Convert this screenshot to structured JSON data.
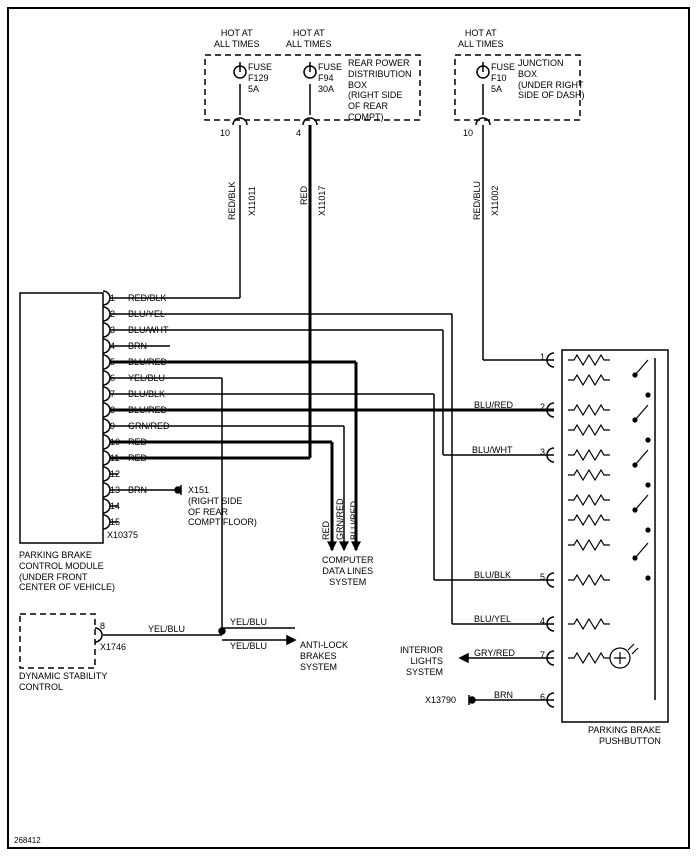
{
  "hot_at_all_times": "HOT AT\nALL TIMES",
  "fuse": "FUSE",
  "fuse_f129": "F129",
  "amp_5a": "5A",
  "fuse_f94": "F94",
  "amp_30a": "30A",
  "fuse_f10": "F10",
  "rear_power_box": "REAR POWER\nDISTRIBUTION\nBOX\n(RIGHT SIDE\nOF REAR\nCOMPT)",
  "junction_box": "JUNCTION\nBOX\n(UNDER RIGHT\nSIDE OF DASH)",
  "conn_pin_10": "10",
  "conn_pin_4": "4",
  "x11011": "X11011",
  "x11017": "X11017",
  "x11002": "X11002",
  "wire_red_blk": "RED/BLK",
  "wire_red": "RED",
  "wire_red_blu": "RED/BLU",
  "module_pins": [
    {
      "n": "1",
      "c": "RED/BLK"
    },
    {
      "n": "2",
      "c": "BLU/YEL"
    },
    {
      "n": "3",
      "c": "BLU/WHT"
    },
    {
      "n": "4",
      "c": "BRN"
    },
    {
      "n": "5",
      "c": "BLU/RED"
    },
    {
      "n": "6",
      "c": "YEL/BLU"
    },
    {
      "n": "7",
      "c": "BLU/BLK"
    },
    {
      "n": "8",
      "c": "BLU/RED"
    },
    {
      "n": "9",
      "c": "GRN/RED"
    },
    {
      "n": "10",
      "c": "RED"
    },
    {
      "n": "11",
      "c": "RED"
    },
    {
      "n": "12",
      "c": ""
    },
    {
      "n": "13",
      "c": "BRN"
    },
    {
      "n": "14",
      "c": ""
    },
    {
      "n": "15",
      "c": ""
    }
  ],
  "x10375": "X10375",
  "parking_brake_module": "PARKING BRAKE\nCONTROL MODULE\n(UNDER FRONT\nCENTER OF VEHICLE)",
  "x151_label": "X151\n(RIGHT SIDE\nOF REAR\nCOMPT FLOOR)",
  "computer_data": "COMPUTER\nDATA LINES\nSYSTEM",
  "conn8": "8",
  "x1746": "X1746",
  "dynamic_stability": "DYNAMIC STABILITY\nCONTROL",
  "yel_blu": "YEL/BLU",
  "anti_lock_brakes": "ANTI-LOCK\nBRAKES\nSYSTEM",
  "interior_lights": "INTERIOR\nLIGHTS\nSYSTEM",
  "gry_red": "GRY/RED",
  "brn": "BRN",
  "x13790": "X13790",
  "pushbutton_pins": [
    {
      "n": "1",
      "c": ""
    },
    {
      "n": "2",
      "c": "BLU/RED"
    },
    {
      "n": "3",
      "c": "BLU/WHT"
    },
    {
      "n": "5",
      "c": "BLU/BLK"
    },
    {
      "n": "4",
      "c": "BLU/YEL"
    },
    {
      "n": "7",
      "c": "GRY/RED"
    },
    {
      "n": "6",
      "c": "BRN"
    }
  ],
  "parking_brake_pushbutton": "PARKING BRAKE\nPUSHBUTTON",
  "diagram_id": "268412",
  "v_red": "RED",
  "v_grn_red": "GRN/RED",
  "v_blu_red": "BLU/RED"
}
